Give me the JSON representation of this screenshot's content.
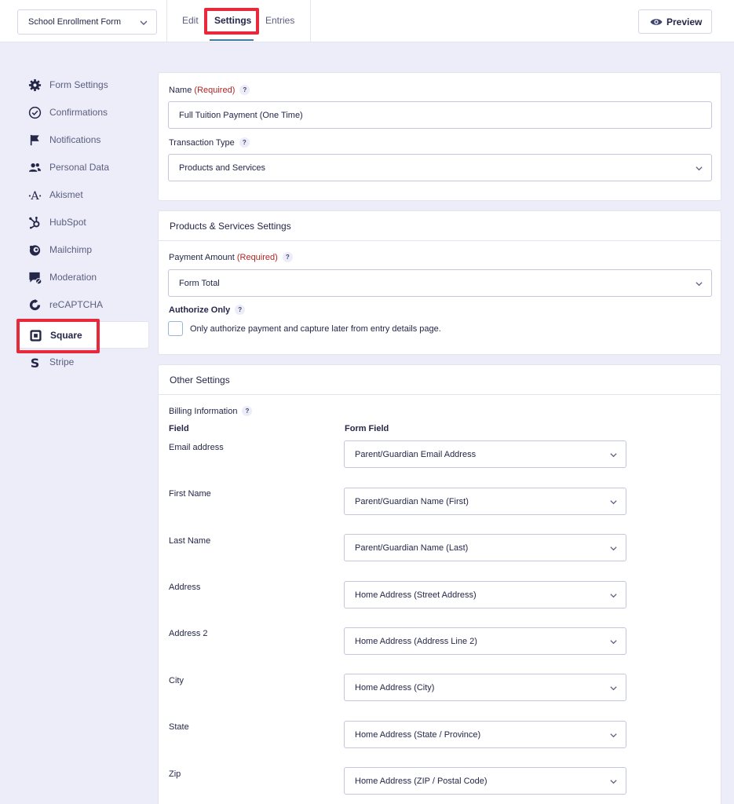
{
  "header": {
    "form_selector": "School Enrollment Form",
    "tabs": [
      "Edit",
      "Settings",
      "Entries"
    ],
    "preview_label": "Preview"
  },
  "sidebar": {
    "items": [
      {
        "label": "Form Settings",
        "icon": "gear-icon"
      },
      {
        "label": "Confirmations",
        "icon": "check-circle-icon"
      },
      {
        "label": "Notifications",
        "icon": "flag-icon"
      },
      {
        "label": "Personal Data",
        "icon": "users-icon"
      },
      {
        "label": "Akismet",
        "icon": "akismet-icon"
      },
      {
        "label": "HubSpot",
        "icon": "hubspot-icon"
      },
      {
        "label": "Mailchimp",
        "icon": "mailchimp-icon"
      },
      {
        "label": "Moderation",
        "icon": "moderation-icon"
      },
      {
        "label": "reCAPTCHA",
        "icon": "recaptcha-icon"
      },
      {
        "label": "Square",
        "icon": "square-icon"
      },
      {
        "label": "Stripe",
        "icon": "stripe-icon"
      }
    ]
  },
  "feed": {
    "name_label": "Name",
    "required_text": "(Required)",
    "help_glyph": "?",
    "name_value": "Full Tuition Payment (One Time)",
    "transaction_type_label": "Transaction Type",
    "transaction_type_value": "Products and Services"
  },
  "products": {
    "title": "Products & Services Settings",
    "payment_amount_label": "Payment Amount",
    "payment_amount_value": "Form Total",
    "authorize_label": "Authorize Only",
    "authorize_checkbox_label": "Only authorize payment and capture later from entry details page."
  },
  "other": {
    "title": "Other Settings",
    "billing_label": "Billing Information",
    "col_field": "Field",
    "col_form_field": "Form Field",
    "rows": [
      {
        "field": "Email address",
        "value": "Parent/Guardian Email Address"
      },
      {
        "field": "First Name",
        "value": "Parent/Guardian Name (First)"
      },
      {
        "field": "Last Name",
        "value": "Parent/Guardian Name (Last)"
      },
      {
        "field": "Address",
        "value": "Home Address (Street Address)"
      },
      {
        "field": "Address 2",
        "value": "Home Address (Address Line 2)"
      },
      {
        "field": "City",
        "value": "Home Address (City)"
      },
      {
        "field": "State",
        "value": "Home Address (State / Province)"
      },
      {
        "field": "Zip",
        "value": "Home Address (ZIP / Postal Code)"
      }
    ]
  }
}
